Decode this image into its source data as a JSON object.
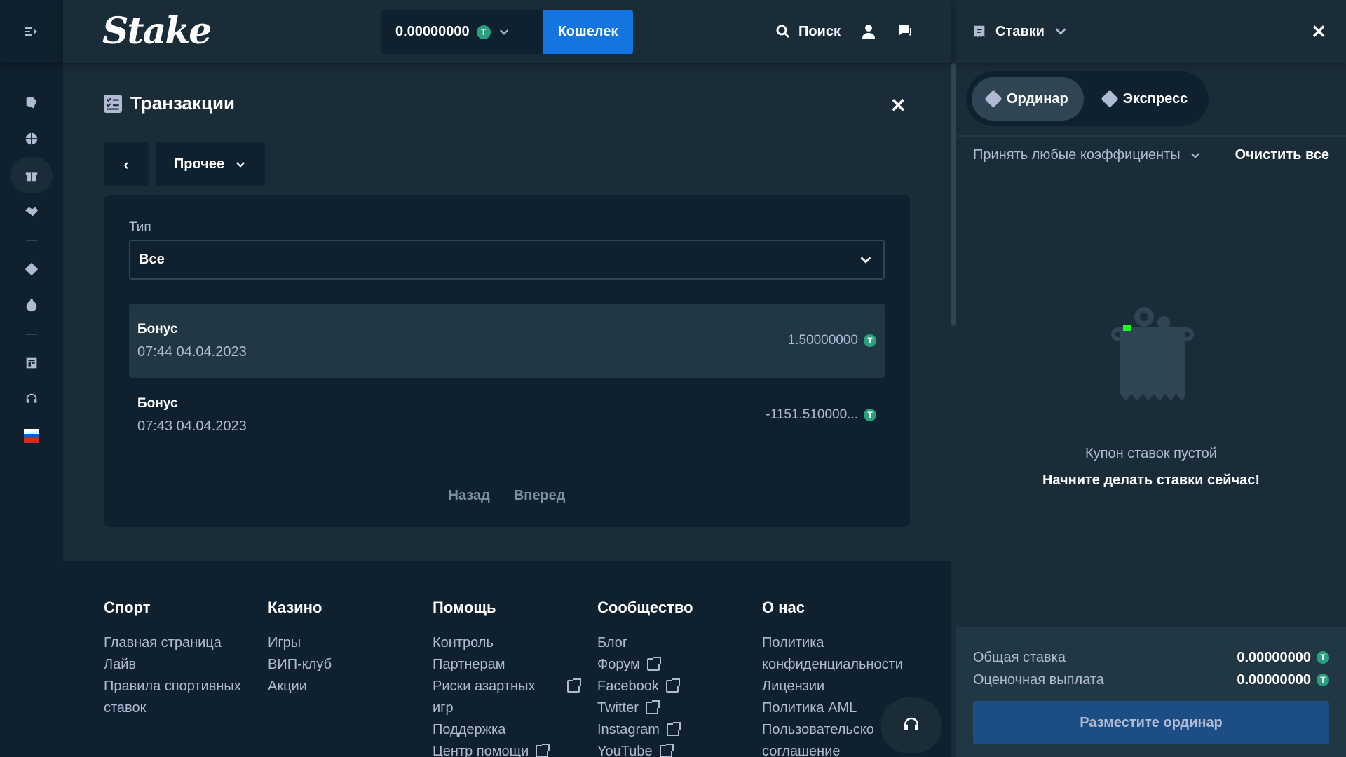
{
  "header": {
    "logo": "Stake",
    "balance": "0.00000000",
    "coin_symbol": "T",
    "wallet_label": "Кошелек",
    "search_label": "Поиск"
  },
  "modal": {
    "title": "Транзакции",
    "filter_label": "Прочее",
    "type_label": "Тип",
    "type_value": "Все",
    "transactions": [
      {
        "type": "Бонус",
        "time": "07:44 04.04.2023",
        "amount": "1.50000000"
      },
      {
        "type": "Бонус",
        "time": "07:43 04.04.2023",
        "amount": "-1151.510000..."
      }
    ],
    "pager": {
      "prev": "Назад",
      "next": "Вперед"
    }
  },
  "footer": {
    "columns": [
      {
        "title": "Спорт",
        "links": [
          "Главная страница",
          "Лайв",
          "Правила спортивных",
          "ставок"
        ]
      },
      {
        "title": "Казино",
        "links": [
          "Игры",
          "ВИП-клуб",
          "Акции"
        ]
      },
      {
        "title": "Помощь",
        "links": [
          "Контроль",
          "Партнерам",
          "Риски азартных",
          "игр",
          "Поддержка",
          "Центр помощи"
        ]
      },
      {
        "title": "Сообщество",
        "links": [
          "Блог",
          "Форум",
          "Facebook",
          "Twitter",
          "Instagram",
          "YouTube"
        ]
      },
      {
        "title": "О нас",
        "links": [
          "Политика",
          "конфиденциальности",
          "Лицензии",
          "Политика AML",
          "Пользовательско",
          "соглашение"
        ]
      }
    ]
  },
  "slip": {
    "title": "Ставки",
    "tab_single": "Ординар",
    "tab_multi": "Экспресс",
    "accept_odds": "Принять любые коэффициенты",
    "clear_all": "Очистить все",
    "empty_title": "Купон ставок пустой",
    "empty_cta": "Начните делать ставки сейчас!",
    "total_stake_label": "Общая ставка",
    "total_stake_value": "0.00000000",
    "est_payout_label": "Оценочная выплата",
    "est_payout_value": "0.00000000",
    "place_label": "Разместите ординар"
  },
  "colors": {
    "bg": "#1a2c38",
    "panel": "#0f212e",
    "accent_blue": "#1475e1",
    "coin_green": "#26a17b"
  }
}
